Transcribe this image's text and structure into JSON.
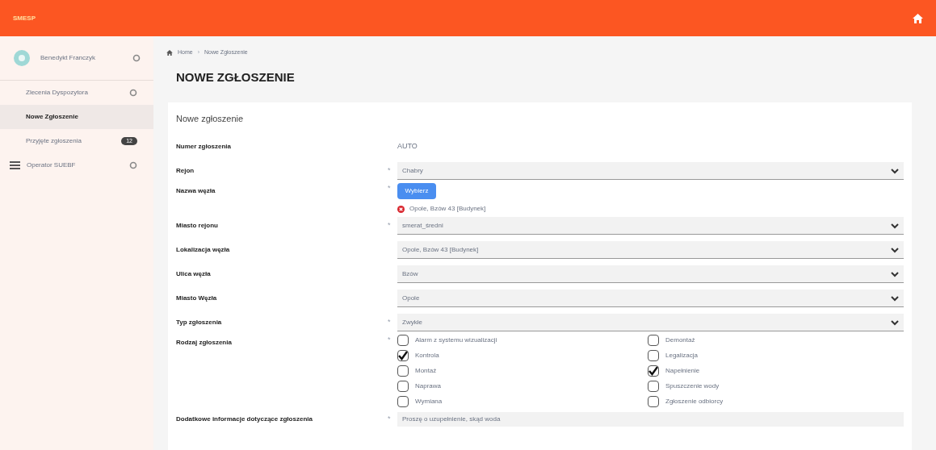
{
  "topbar": {
    "logo": "SMESP"
  },
  "sidebar": {
    "user": "Benedykt Franczyk",
    "items": [
      {
        "label": "Zlecenia Dyspozytora",
        "selected": false,
        "kind": "expand"
      },
      {
        "label": "Nowe Zgłoszenie",
        "selected": true,
        "kind": "sub"
      },
      {
        "label": "Przyjęte zgłoszenia",
        "selected": false,
        "kind": "badge",
        "badge": "12"
      },
      {
        "label": "Operator SUEBF",
        "selected": false,
        "kind": "section"
      }
    ]
  },
  "breadcrumb": {
    "items": [
      "Home",
      "Nowe Zgłoszenie"
    ],
    "separator": "›"
  },
  "page_title": "NOWE ZGŁOSZENIE",
  "card_title": "Nowe zgłoszenie",
  "fields": [
    {
      "label": "Numer zgłoszenia",
      "kind": "text",
      "value": "AUTO"
    },
    {
      "label": "Rejon",
      "kind": "select",
      "value": "Chabry",
      "required_mark": "*"
    },
    {
      "label": "Nazwa węzła",
      "kind": "picker",
      "button": "Wybierz",
      "value": "Opole, Bzów 43 [Budynek]",
      "required_mark": "*"
    },
    {
      "label": "Miasto rejonu",
      "kind": "select",
      "value": "smerat_średni",
      "required_mark": "*"
    },
    {
      "label": "Lokalizacja węzła",
      "kind": "select",
      "value": "Opole, Bzów 43 [Budynek]"
    },
    {
      "label": "Ulica węzła",
      "kind": "select",
      "value": "Bzów"
    },
    {
      "label": "Miasto Węzła",
      "kind": "select",
      "value": "Opole"
    },
    {
      "label": "Typ zgłoszenia",
      "kind": "select",
      "value": "Zwykłe",
      "required_mark": "*"
    },
    {
      "label": "Rodzaj zgłoszenia",
      "kind": "checks",
      "required_mark": "*",
      "options": [
        {
          "label": "Alarm z systemu wizualizacji",
          "checked": false
        },
        {
          "label": "Kontrola",
          "checked": true
        },
        {
          "label": "Montaż",
          "checked": false
        },
        {
          "label": "Naprawa",
          "checked": false
        },
        {
          "label": "Wymiana",
          "checked": false
        },
        {
          "label": "Demontaż",
          "checked": false
        },
        {
          "label": "Legalizacja",
          "checked": false
        },
        {
          "label": "Napełnienie",
          "checked": true
        },
        {
          "label": "Spuszczenie wody",
          "checked": false
        },
        {
          "label": "Zgłoszenie odbiorcy",
          "checked": false
        }
      ]
    },
    {
      "label": "Dodatkowe informacje dotyczące zgłoszenia",
      "kind": "textarea",
      "value": "Proszę o uzupełnienie, skąd woda",
      "required_mark": "*"
    }
  ]
}
